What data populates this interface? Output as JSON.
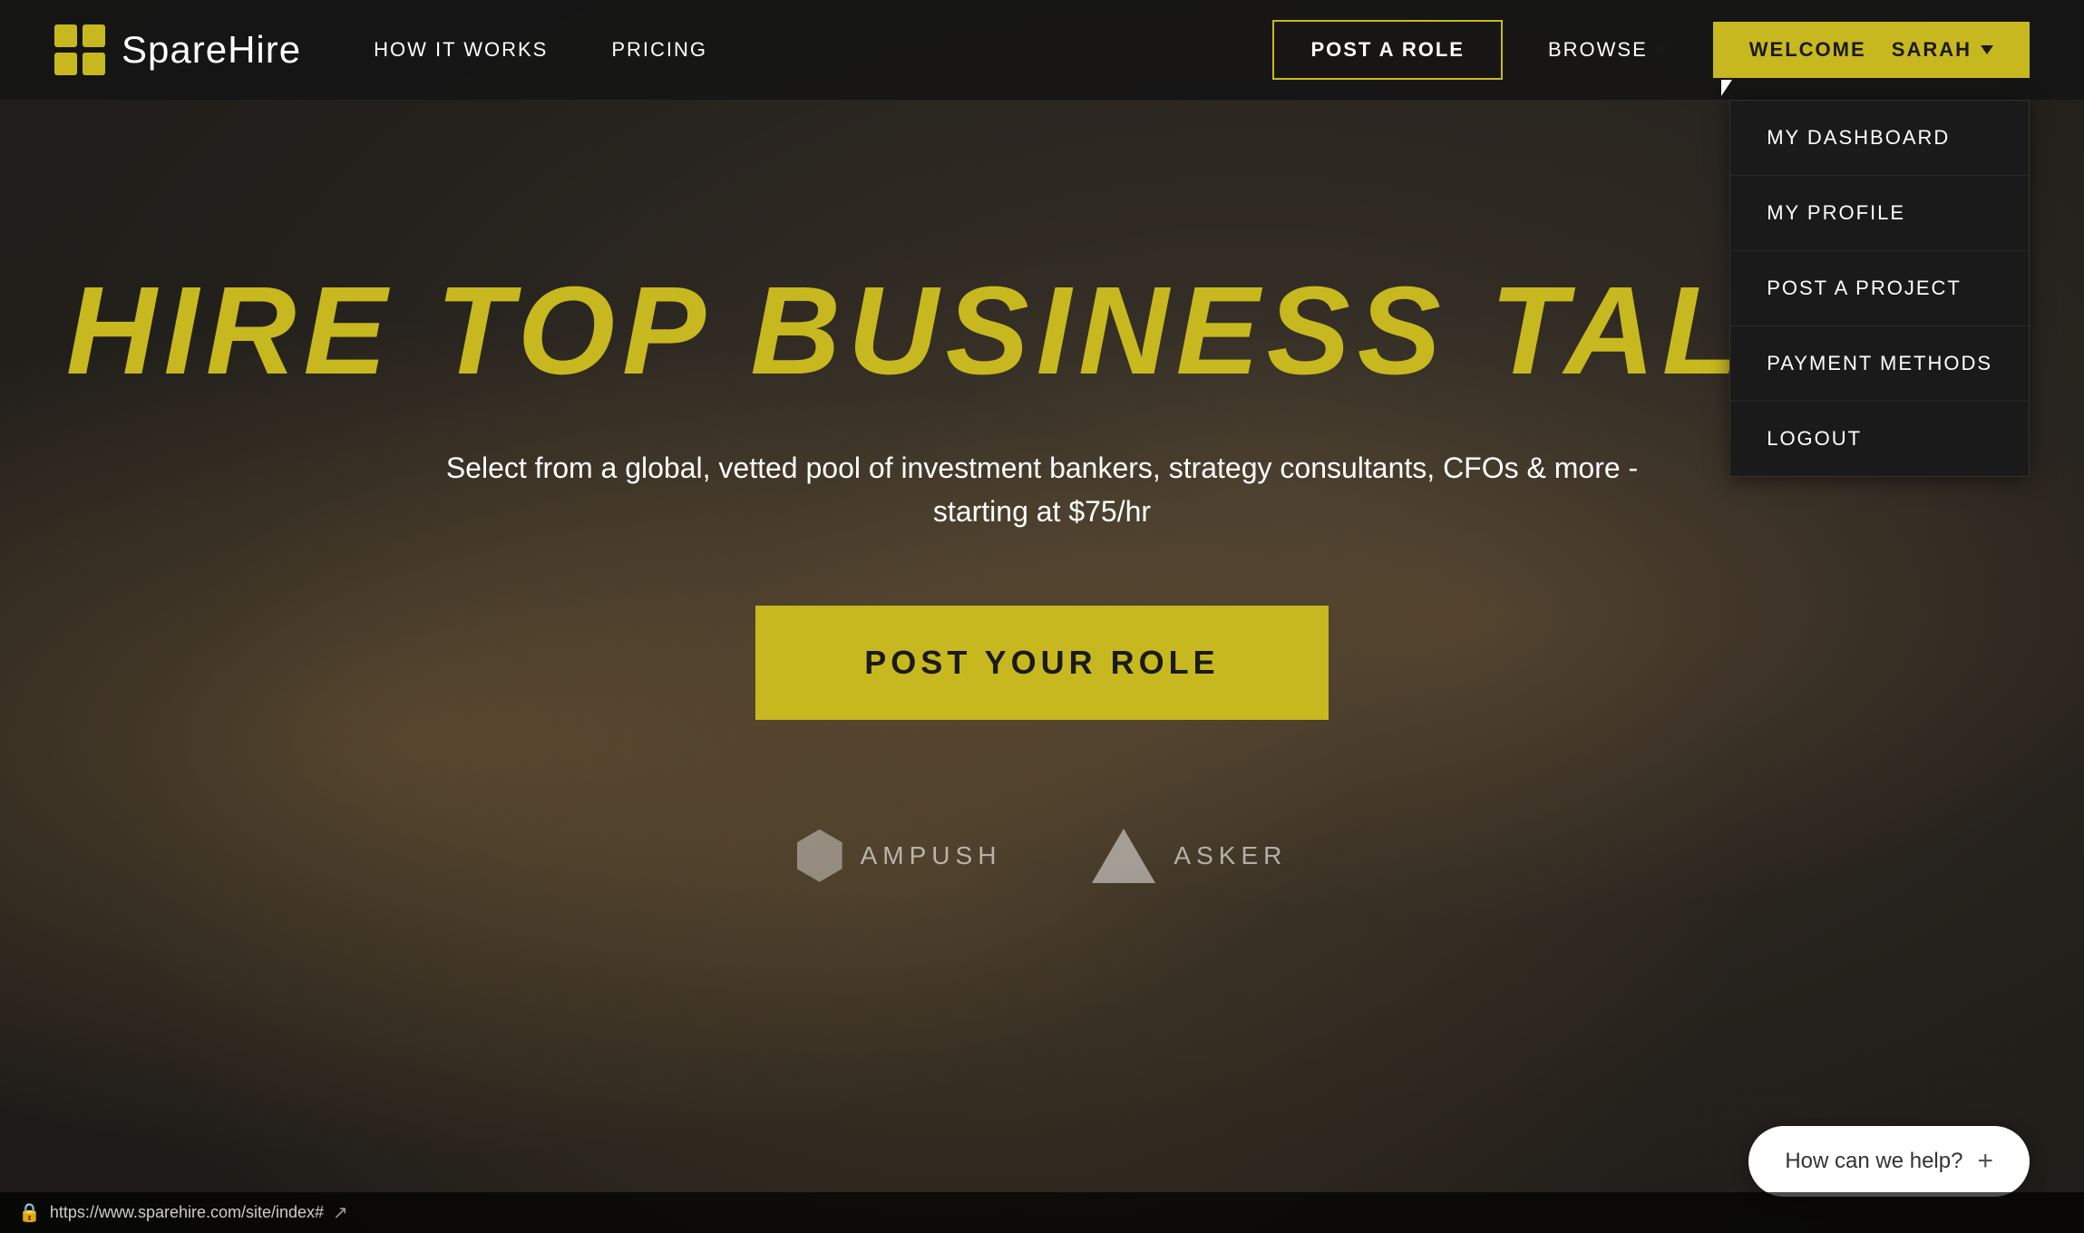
{
  "brand": {
    "name": "SpareHire",
    "logo_squares": 4
  },
  "navbar": {
    "nav_links": [
      {
        "id": "how-it-works",
        "label": "HOW IT WORKS"
      },
      {
        "id": "pricing",
        "label": "PRICING"
      }
    ],
    "post_role_label": "POST A ROLE",
    "browse_label": "BROWSE",
    "welcome_label": "Welcome",
    "user_name": "SARAH",
    "dropdown_arrow": "▾"
  },
  "dropdown": {
    "items": [
      {
        "id": "my-dashboard",
        "label": "MY DASHBOARD"
      },
      {
        "id": "my-profile",
        "label": "MY PROFILE"
      },
      {
        "id": "post-project",
        "label": "POST A PROJECT"
      },
      {
        "id": "payment-methods",
        "label": "PAYMENT METHODS"
      },
      {
        "id": "logout",
        "label": "LOGOUT"
      }
    ]
  },
  "hero": {
    "title": "HIRE TOP BUSINESS TALENT",
    "subtitle": "Select from a global, vetted pool of investment bankers, strategy consultants, CFOs & more - starting at $75/hr",
    "cta_label": "POST YOUR ROLE"
  },
  "brands": [
    {
      "name": "AMPUSH",
      "icon_type": "hex"
    },
    {
      "name": "ASKER",
      "icon_type": "triangle"
    }
  ],
  "chat": {
    "label": "How can we help?",
    "plus": "+"
  },
  "statusbar": {
    "url": "https://www.sparehire.com/site/index#"
  }
}
